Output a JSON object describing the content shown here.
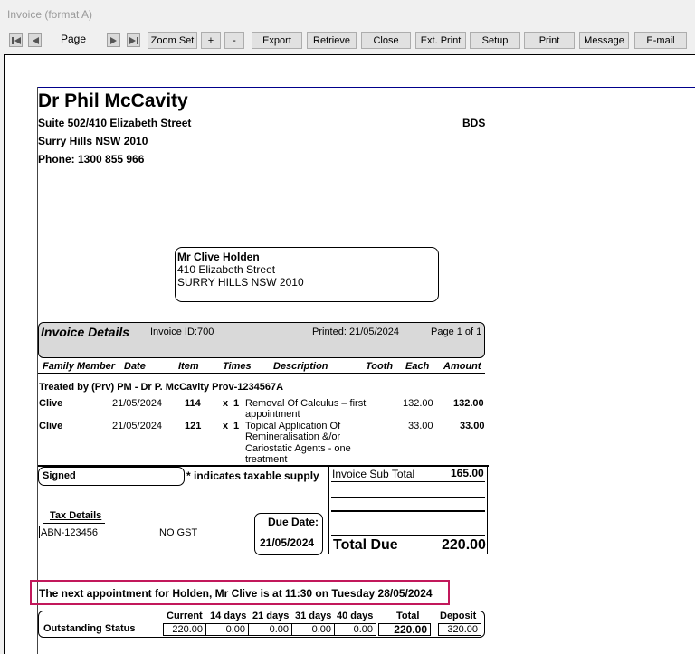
{
  "window": {
    "title": "Invoice (format A)"
  },
  "toolbar": {
    "page_label": "Page",
    "zoom_set": "Zoom Set",
    "zoom_in": "+",
    "zoom_out": "-",
    "export": "Export",
    "retrieve": "Retrieve",
    "close": "Close",
    "ext_print": "Ext. Print",
    "setup": "Setup",
    "print": "Print",
    "message": "Message",
    "email": "E-mail"
  },
  "practice": {
    "name": "Dr Phil McCavity",
    "address1": "Suite 502/410 Elizabeth Street",
    "address2": "Surry Hills NSW 2010",
    "phone": "Phone: 1300 855 966",
    "qualification": "BDS"
  },
  "patient": {
    "name": "Mr Clive  Holden",
    "address1": "410 Elizabeth Street",
    "address2": "SURRY HILLS NSW 2010"
  },
  "invoice_header": {
    "title": "Invoice Details",
    "invoice_id": "Invoice ID:700",
    "printed": "Printed: 21/05/2024",
    "page": "Page 1 of 1"
  },
  "columns": {
    "family_member": "Family Member",
    "date": "Date",
    "item": "Item",
    "times": "Times",
    "description": "Description",
    "tooth": "Tooth",
    "each": "Each",
    "amount": "Amount"
  },
  "treated_by": "Treated by (Prv) PM - Dr P. McCavity Prov-1234567A",
  "line_items": [
    {
      "member": "Clive",
      "date": "21/05/2024",
      "item": "114",
      "times_x": "x",
      "times": "1",
      "description": "Removal Of Calculus – first appointment",
      "each": "132.00",
      "amount": "132.00"
    },
    {
      "member": "Clive",
      "date": "21/05/2024",
      "item": "121",
      "times_x": "x",
      "times": "1",
      "description": "Topical Application Of Remineralisation &/or Cariostatic Agents - one treatment",
      "each": "33.00",
      "amount": "33.00"
    }
  ],
  "signed_label": "Signed",
  "taxable_note": "* indicates taxable supply",
  "totals": {
    "sub_total_label": "Invoice Sub Total",
    "sub_total": "165.00",
    "total_due_label": "Total Due",
    "total_due": "220.00"
  },
  "tax": {
    "title": "Tax Details",
    "abn": "ABN-123456",
    "gst": "NO GST"
  },
  "due": {
    "label": "Due Date:",
    "date": "21/05/2024"
  },
  "appointment_note": "The next appointment for Holden, Mr Clive is at 11:30 on Tuesday 28/05/2024",
  "outstanding": {
    "label": "Outstanding Status",
    "headers": [
      "Current",
      "14 days",
      "21 days",
      "31 days",
      "40 days",
      "Total",
      "Deposit"
    ],
    "values": [
      "220.00",
      "0.00",
      "0.00",
      "0.00",
      "0.00",
      "220.00",
      "320.00"
    ]
  },
  "colors": {
    "highlight": "#c2185b",
    "header_fill": "#d9d9d9",
    "accent_line": "#00008b"
  }
}
